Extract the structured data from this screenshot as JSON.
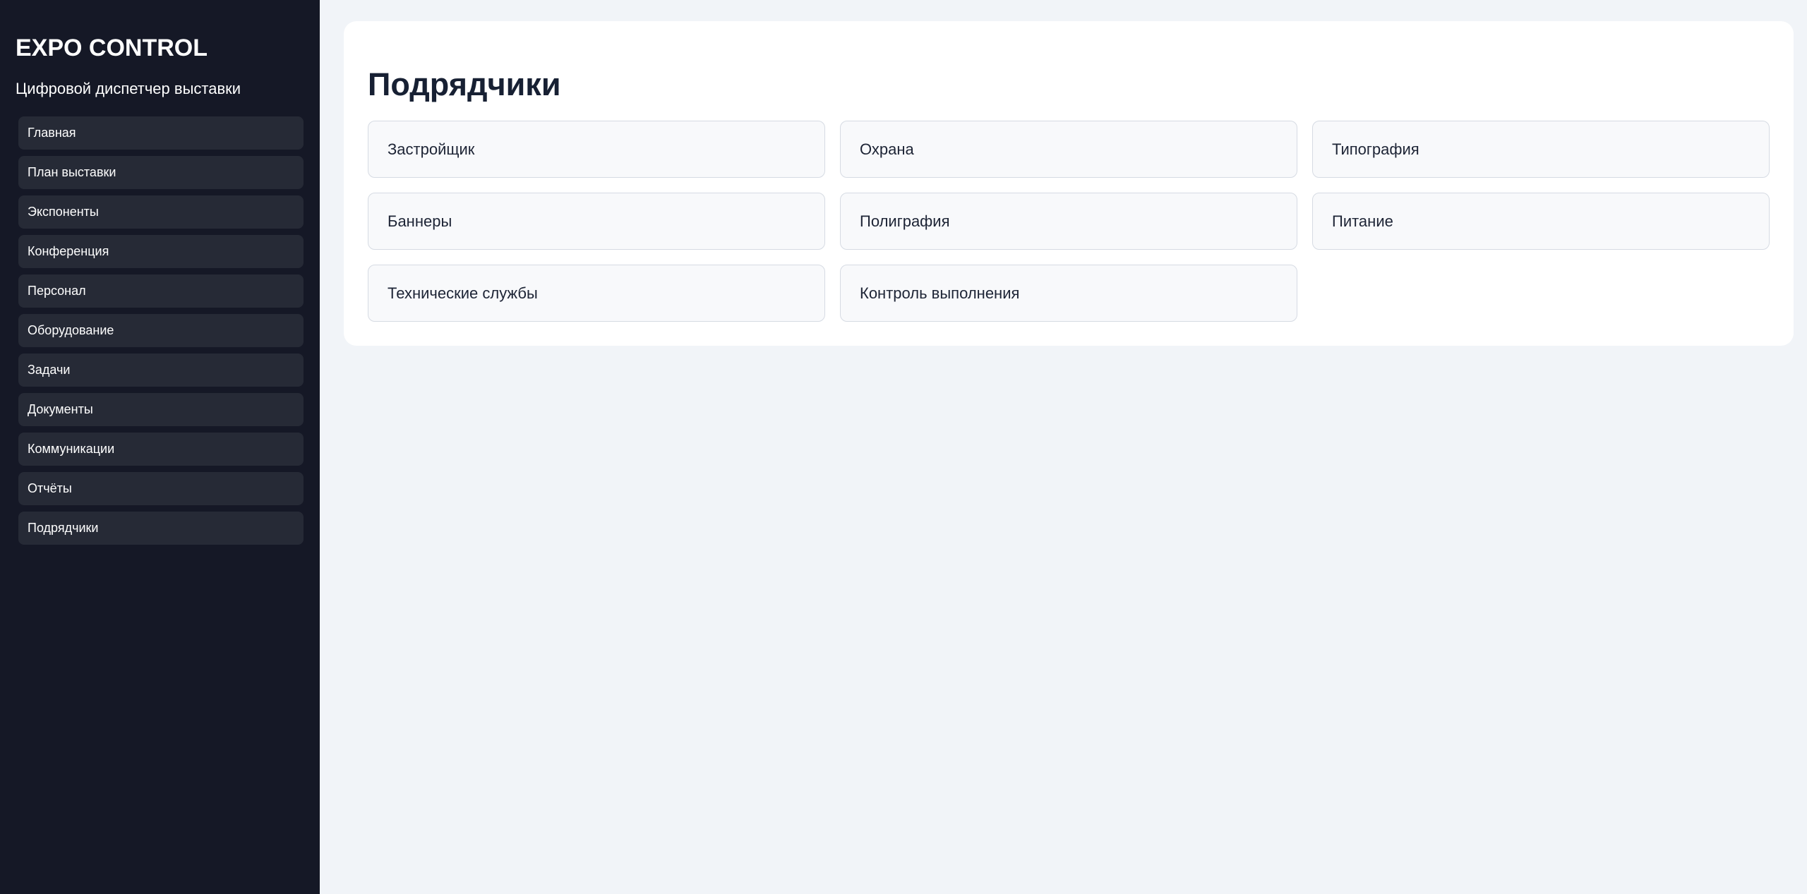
{
  "sidebar": {
    "title": "EXPO CONTROL",
    "subtitle": "Цифровой диспетчер выставки",
    "items": [
      {
        "label": "Главная"
      },
      {
        "label": "План выставки"
      },
      {
        "label": "Экспоненты"
      },
      {
        "label": "Конференция"
      },
      {
        "label": "Персонал"
      },
      {
        "label": "Оборудование"
      },
      {
        "label": "Задачи"
      },
      {
        "label": "Документы"
      },
      {
        "label": "Коммуникации"
      },
      {
        "label": "Отчёты"
      },
      {
        "label": "Подрядчики"
      }
    ]
  },
  "main": {
    "title": "Подрядчики",
    "contractors": [
      {
        "label": "Застройщик"
      },
      {
        "label": "Охрана"
      },
      {
        "label": "Типография"
      },
      {
        "label": "Баннеры"
      },
      {
        "label": "Полиграфия"
      },
      {
        "label": "Питание"
      },
      {
        "label": "Технические службы"
      },
      {
        "label": "Контроль выполнения"
      }
    ]
  },
  "colors": {
    "sidebar_background": "#151826",
    "sidebar_item_background": "#262a36",
    "page_background": "#f1f4f8",
    "card_background": "#ffffff",
    "contractor_background": "#f8f9fb",
    "text_dark": "#172033"
  }
}
